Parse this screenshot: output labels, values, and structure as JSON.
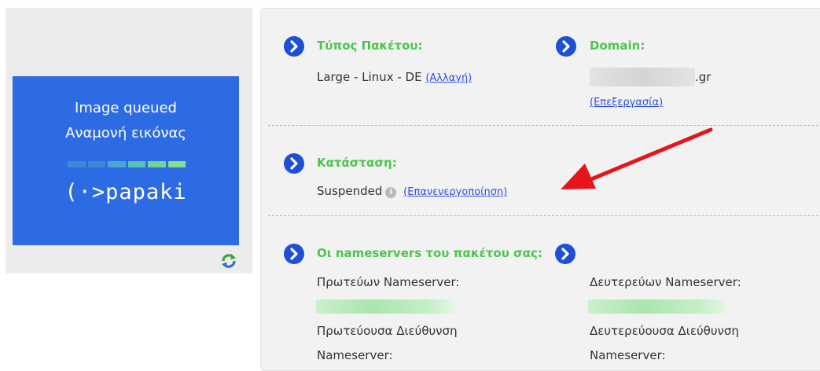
{
  "preview": {
    "line1": "Image queued",
    "line2": "Αναμονή εικόνας",
    "logo": "(·>papaki",
    "bg_color": "#2d6be4",
    "bar_colors": [
      "#3f88d6",
      "#3f88d6",
      "#4aa7d3",
      "#58c2b6",
      "#6fd49a",
      "#84e08a"
    ],
    "refresh_icon": "refresh-icon"
  },
  "package": {
    "heading": "Τύπος Πακέτου:",
    "value": "Large - Linux - DE",
    "change_link": "(Αλλαγή)"
  },
  "domain": {
    "heading": "Domain:",
    "suffix": ".gr",
    "edit_link": "(Επεξεργασία)"
  },
  "status": {
    "heading": "Κατάσταση:",
    "value": "Suspended",
    "info_icon": "info-icon",
    "reactivate_link": "(Επανενεργοποίηση)"
  },
  "nameservers": {
    "heading": "Οι nameservers του πακέτου σας:",
    "primary_label": "Πρωτεύων Nameserver:",
    "secondary_label": "Δευτερεύων Nameserver:",
    "primary_addr_label": "Πρωτεύουσα Διεύθυνση",
    "secondary_addr_label": "Δευτερεύουσα Διεύθυνση",
    "cut_label_1": "Nameserver:",
    "cut_label_2": "Nameserver:"
  },
  "colors": {
    "heading_green": "#4cc54b",
    "link_blue": "#2b4ee0",
    "circle_blue": "#1f4fd6",
    "arrow_red": "#e8141b"
  }
}
